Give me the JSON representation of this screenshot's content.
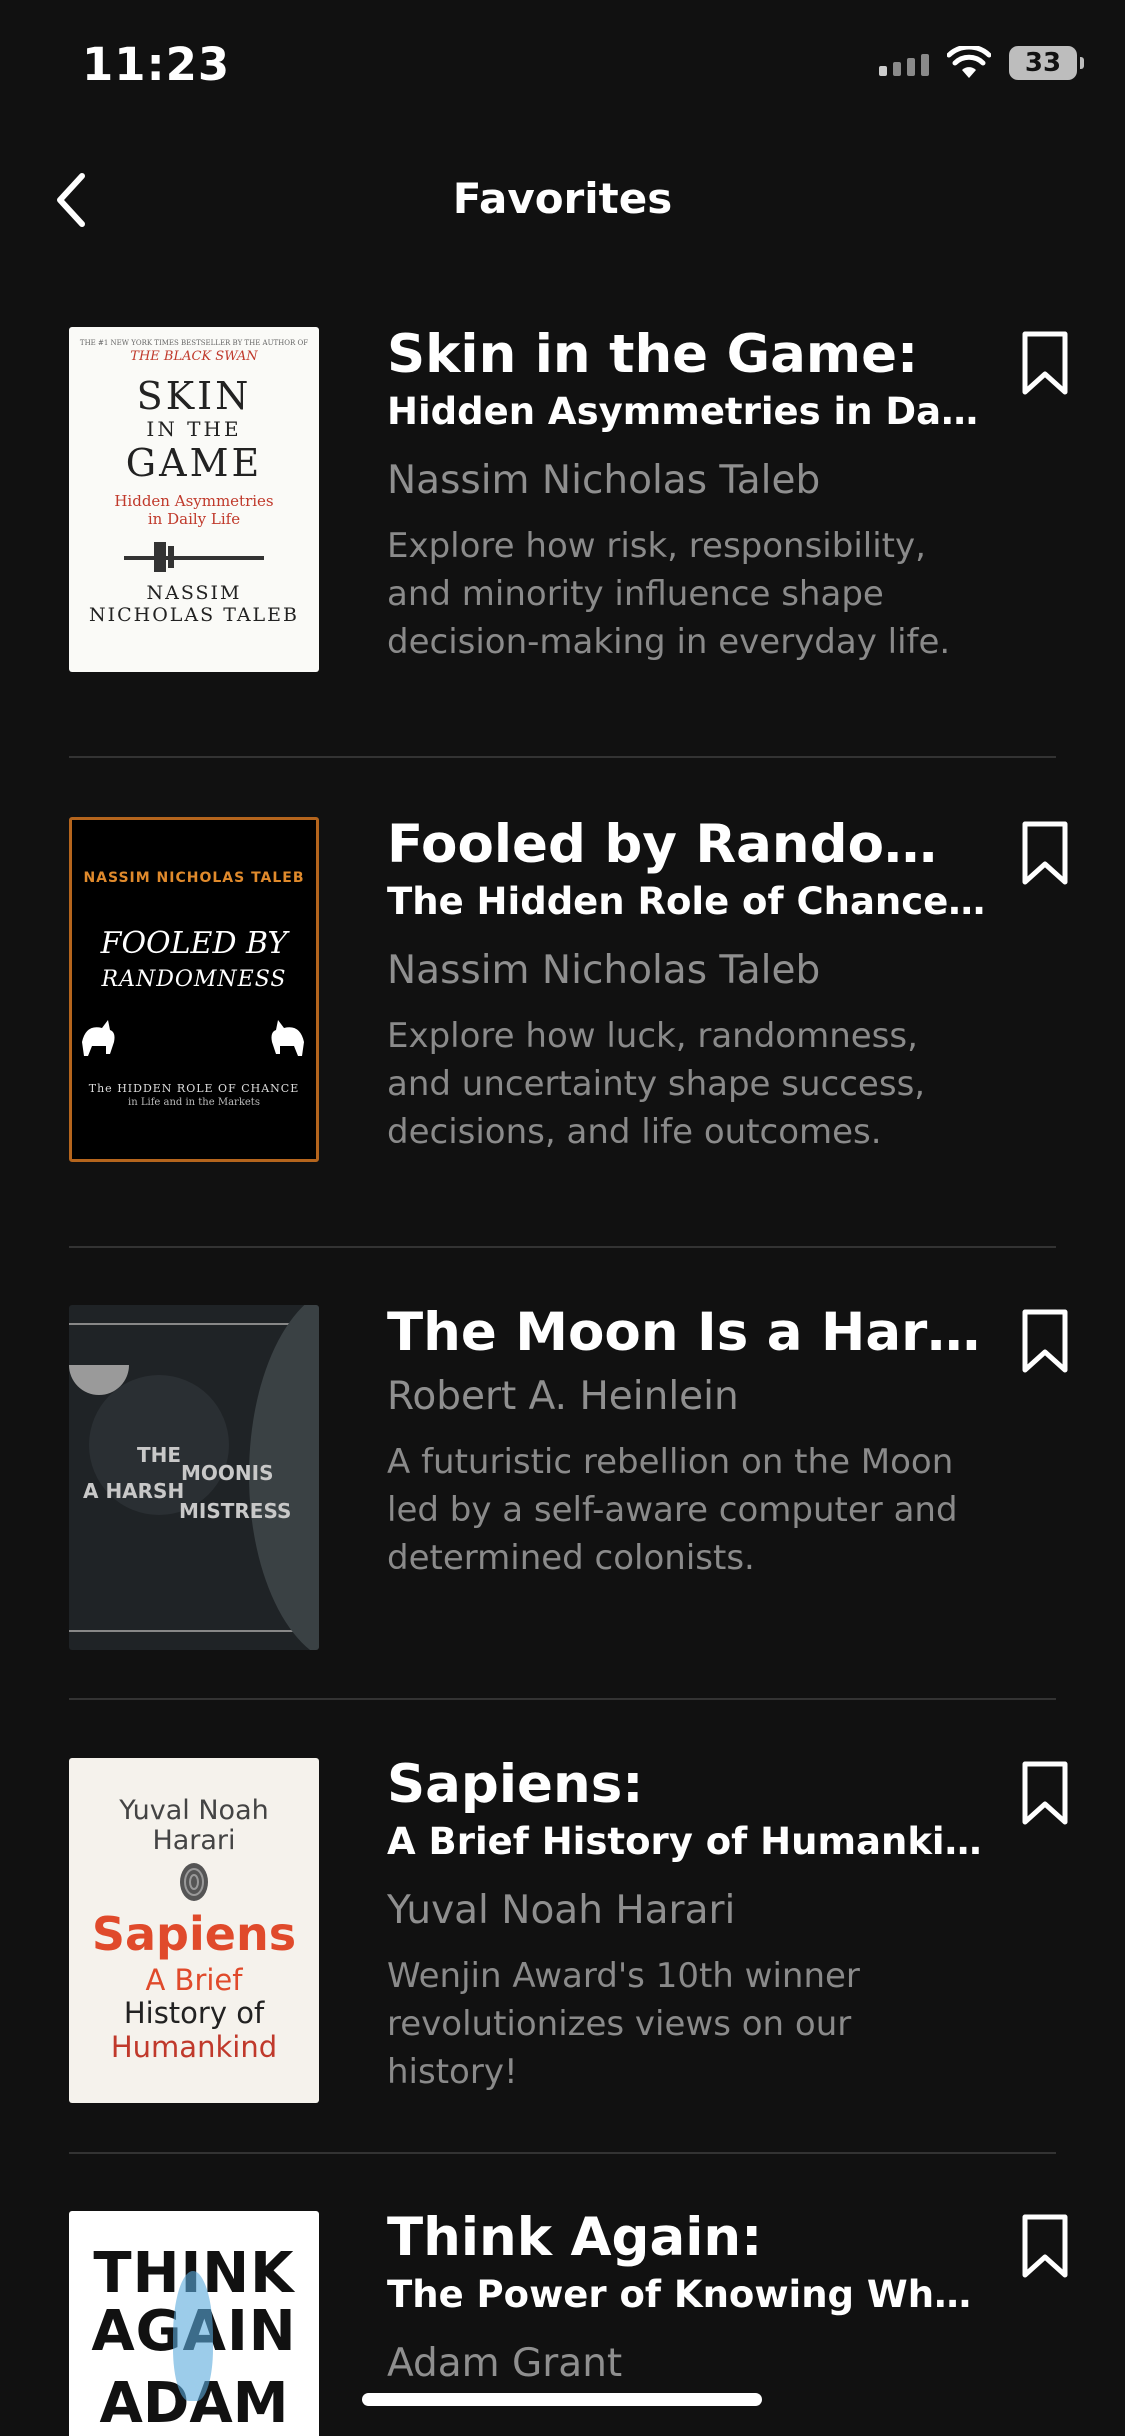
{
  "status_bar": {
    "time": "11:23",
    "battery": "33"
  },
  "nav": {
    "title": "Favorites"
  },
  "books": [
    {
      "title": "Skin in the Game:",
      "subtitle": "Hidden Asymmetries in Dail...",
      "author": "Nassim Nicholas Taleb",
      "description": "Explore how risk, responsibility, and minority influence shape decision-making in everyday life.",
      "cover": {
        "top_line": "THE #1 NEW YORK TIMES BESTSELLER BY THE AUTHOR OF",
        "series": "THE BLACK SWAN",
        "title1": "SKIN",
        "title2": "IN THE",
        "title3": "GAME",
        "sub1": "Hidden Asymmetries",
        "sub2": "in Daily Life",
        "author1": "NASSIM",
        "author2": "NICHOLAS TALEB"
      }
    },
    {
      "title": "Fooled by Random...",
      "subtitle": "The Hidden Role of Chance ...",
      "author": "Nassim Nicholas Taleb",
      "description": "Explore how luck, randomness, and uncertainty shape success, decisions, and life outcomes.",
      "cover": {
        "author": "NASSIM NICHOLAS TALEB",
        "title1": "FOOLED BY",
        "title2": "RANDOMNESS",
        "sub1": "The HIDDEN ROLE OF CHANCE",
        "sub2": "in Life and in the Markets"
      }
    },
    {
      "title": "The Moon Is a Hars...",
      "subtitle": "",
      "author": "Robert A. Heinlein",
      "description": "A futuristic rebellion on the Moon led by a self-aware computer and determined colonists.",
      "cover": {
        "w1": "THE",
        "w2": "MOONIS",
        "w3": "A HARSH",
        "w4": "MISTRESS"
      }
    },
    {
      "title": "Sapiens:",
      "subtitle": "A Brief History of Humankind",
      "author": "Yuval Noah Harari",
      "description": "Wenjin Award's 10th winner revolutionizes views on our history!",
      "cover": {
        "author1": "Yuval Noah",
        "author2": "Harari",
        "title": "Sapiens",
        "sub1": "A Brief",
        "sub2": "History of",
        "sub3": "Humankind"
      }
    },
    {
      "title": "Think Again:",
      "subtitle": "The Power of Knowing Wha...",
      "author": "Adam Grant",
      "description": "",
      "cover": {
        "title1": "THINK",
        "title2": "AGAIN",
        "title3": "ADAM"
      }
    }
  ]
}
